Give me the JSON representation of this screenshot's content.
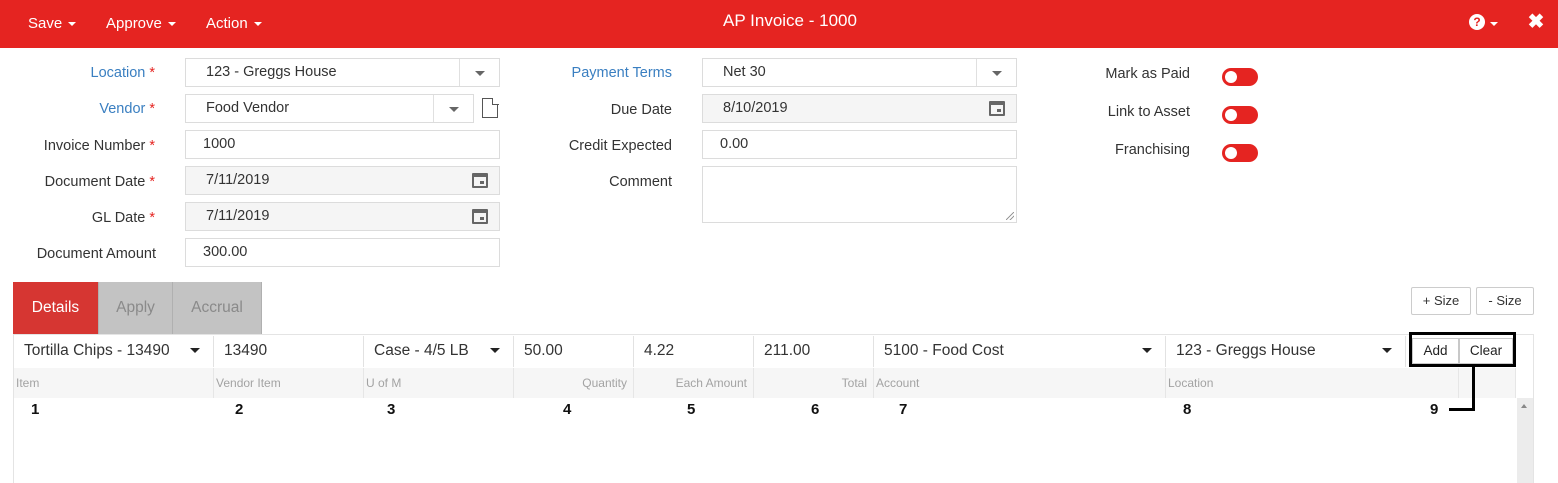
{
  "menu": {
    "save": "Save",
    "approve": "Approve",
    "action": "Action"
  },
  "title": "AP Invoice - 1000",
  "header_icons": {
    "help": "question-circle-icon",
    "close": "close-icon"
  },
  "form": {
    "location": {
      "label": "Location",
      "value": "123 - Greggs House"
    },
    "vendor": {
      "label": "Vendor",
      "value": "Food Vendor"
    },
    "invoice_number": {
      "label": "Invoice Number",
      "value": "1000"
    },
    "document_date": {
      "label": "Document Date",
      "value": "7/11/2019"
    },
    "gl_date": {
      "label": "GL Date",
      "value": "7/11/2019"
    },
    "document_amount": {
      "label": "Document Amount",
      "value": "300.00"
    },
    "payment_terms": {
      "label": "Payment Terms",
      "value": "Net 30"
    },
    "due_date": {
      "label": "Due Date",
      "value": "8/10/2019"
    },
    "credit_expected": {
      "label": "Credit Expected",
      "value": "0.00"
    },
    "comment": {
      "label": "Comment",
      "value": ""
    },
    "required_marker": "*"
  },
  "toggles": [
    {
      "label": "Mark as Paid",
      "on": false
    },
    {
      "label": "Link to Asset",
      "on": false
    },
    {
      "label": "Franchising",
      "on": false
    }
  ],
  "tabs": [
    "Details",
    "Apply",
    "Accrual"
  ],
  "size_buttons": {
    "plus": "+ Size",
    "minus": "- Size"
  },
  "entry_row": {
    "item": "Tortilla Chips - 13490",
    "vendor_item": "13490",
    "uom": "Case - 4/5 LB",
    "quantity": "50.00",
    "each_amount": "4.22",
    "total": "211.00",
    "account": "5100 - Food Cost",
    "location": "123 - Greggs House"
  },
  "grid_buttons": {
    "add": "Add",
    "clear": "Clear"
  },
  "columns": [
    "Item",
    "Vendor Item",
    "U of M",
    "Quantity",
    "Each Amount",
    "Total",
    "Account",
    "Location"
  ],
  "annotations": [
    "1",
    "2",
    "3",
    "4",
    "5",
    "6",
    "7",
    "8",
    "9"
  ],
  "colors": {
    "brand": "#e52421",
    "label_link": "#3a7fc1",
    "tab_active": "#d63632"
  }
}
